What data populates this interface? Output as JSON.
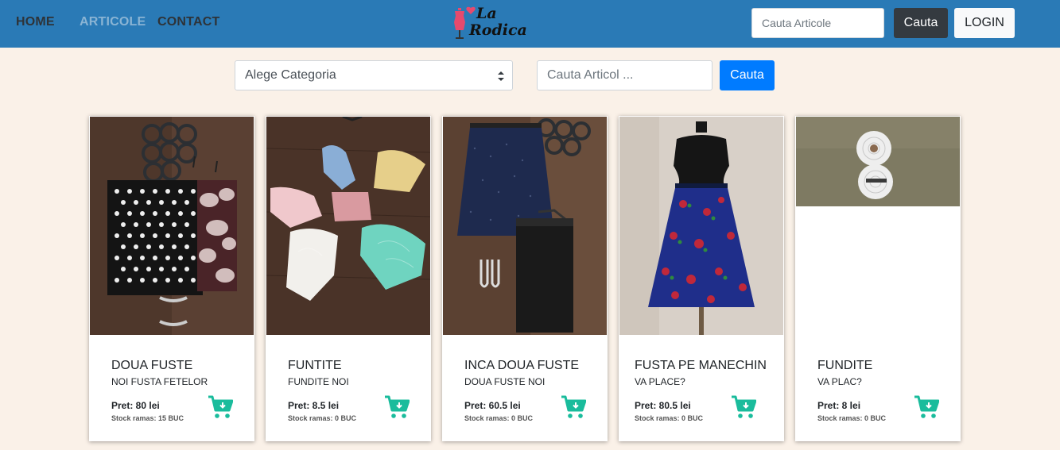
{
  "nav": {
    "home": "HOME",
    "articole": "ARTICOLE",
    "contact": "CONTACT"
  },
  "logo": {
    "line1": "La",
    "line2": "Rodica",
    "icons": [
      "dress-form-icon",
      "heart-icon"
    ]
  },
  "header": {
    "search_placeholder": "Cauta Articole",
    "search_button": "Cauta",
    "login_button": "LOGIN"
  },
  "filters": {
    "category_selected": "Alege Categoria",
    "search_placeholder": "Cauta Articol ...",
    "search_button": "Cauta"
  },
  "colors": {
    "navbar": "#2a7ab6",
    "page_background": "#faf1e8",
    "cart_icon": "#1abc9c",
    "primary_button": "#007bff",
    "dark_button": "#343a40"
  },
  "products": [
    {
      "title": "DOUA FUSTE",
      "subtitle": "NOI FUSTA FETELOR",
      "price": "Pret: 80 lei",
      "stock": "Stock ramas: 15 BUC"
    },
    {
      "title": "FUNTITE",
      "subtitle": "FUNDITE NOI",
      "price": "Pret: 8.5 lei",
      "stock": "Stock ramas: 0 BUC"
    },
    {
      "title": "INCA DOUA FUSTE",
      "subtitle": "DOUA FUSTE NOI",
      "price": "Pret: 60.5 lei",
      "stock": "Stock ramas: 0 BUC"
    },
    {
      "title": "FUSTA PE MANECHIN",
      "subtitle": "VA PLACE?",
      "price": "Pret: 80.5 lei",
      "stock": "Stock ramas: 0 BUC"
    },
    {
      "title": "FUNDITE",
      "subtitle": "VA PLAC?",
      "price": "Pret: 8 lei",
      "stock": "Stock ramas: 0 BUC"
    }
  ]
}
